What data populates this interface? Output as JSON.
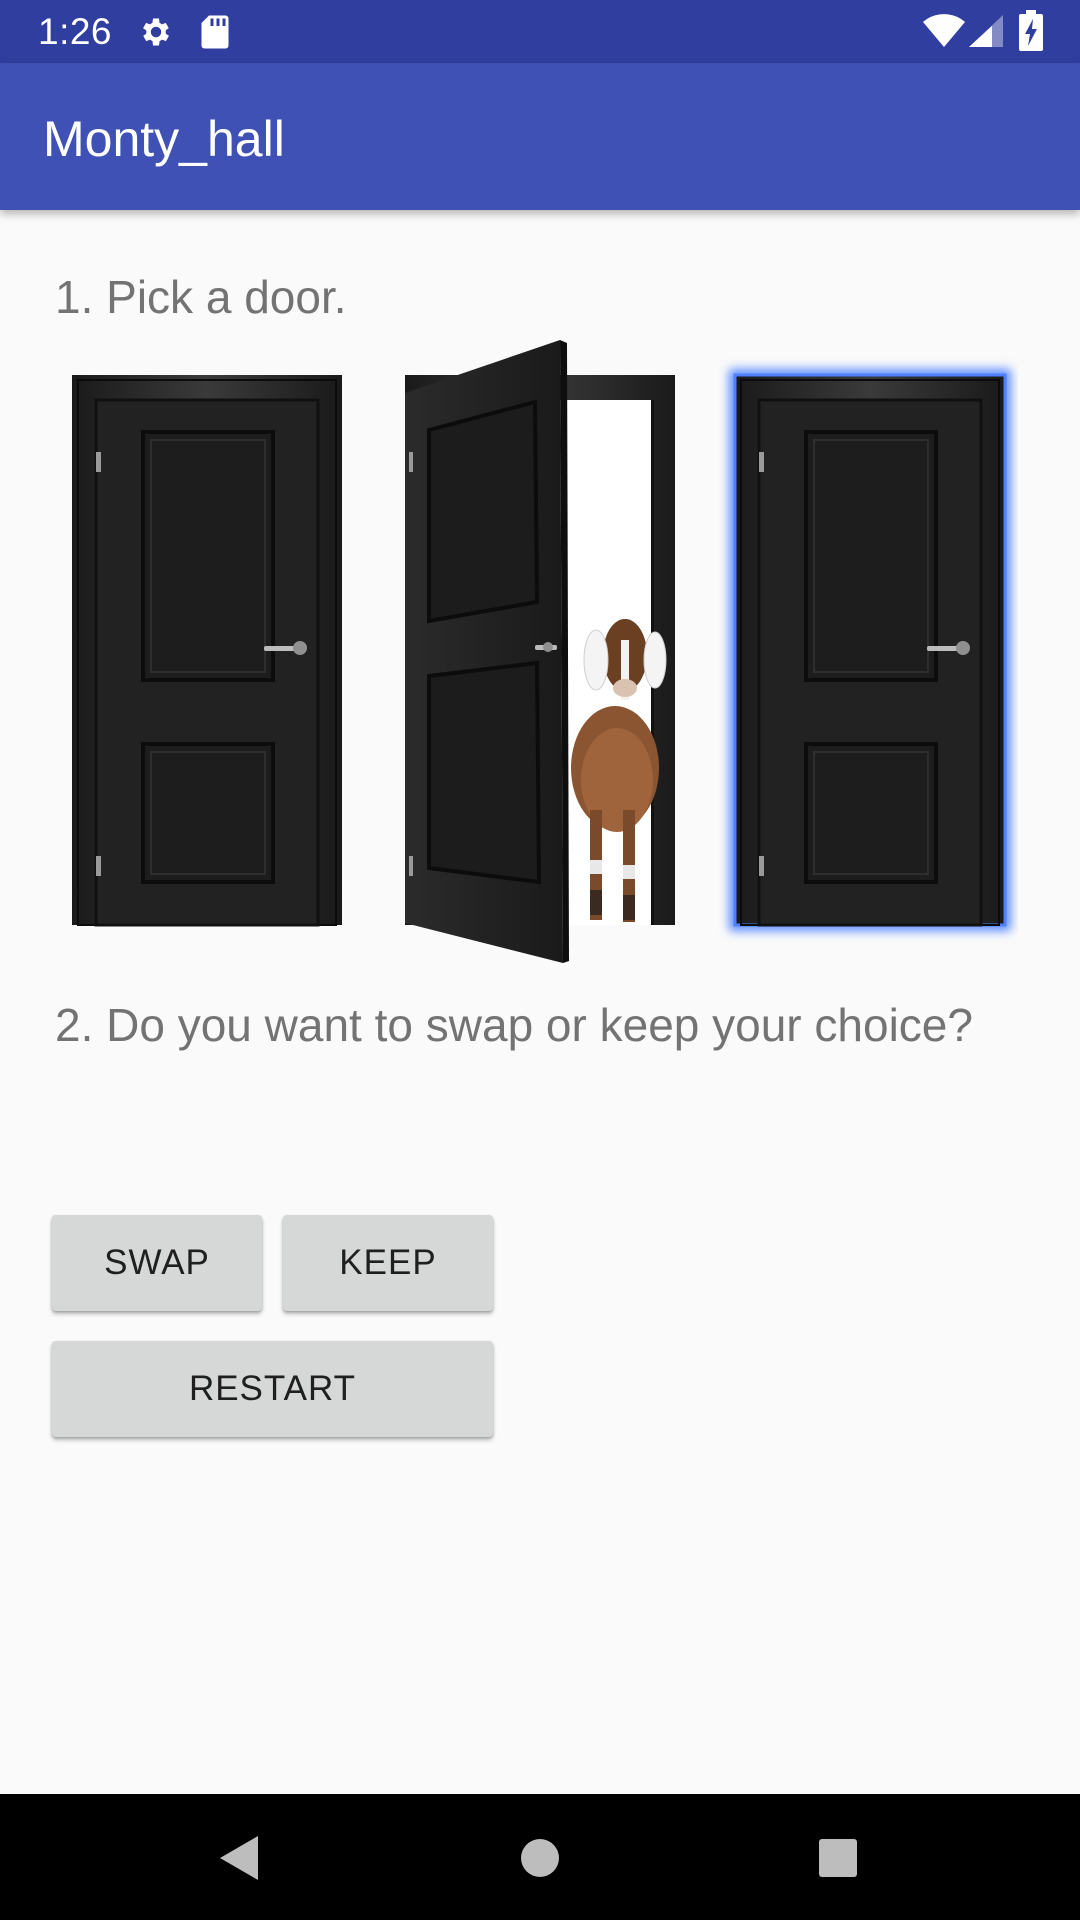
{
  "status_bar": {
    "time": "1:26",
    "icons": [
      "gear-icon",
      "sd-card-icon",
      "wifi-icon",
      "signal-icon",
      "battery-icon"
    ]
  },
  "app_bar": {
    "title": "Monty_hall",
    "color": "#3f51b5",
    "status_color": "#303f9f"
  },
  "content": {
    "step1": "1. Pick a door.",
    "step2": "2. Do you want to swap or keep your choice?",
    "doors": [
      {
        "state": "closed",
        "selected": false
      },
      {
        "state": "open",
        "reveals": "goat",
        "selected": false
      },
      {
        "state": "closed",
        "selected": true
      }
    ],
    "selection_glow_color": "#5b8cff"
  },
  "buttons": {
    "swap": "SWAP",
    "keep": "KEEP",
    "restart": "RESTART"
  },
  "nav_bar": {
    "icons": [
      "back-icon",
      "home-icon",
      "recents-icon"
    ]
  }
}
